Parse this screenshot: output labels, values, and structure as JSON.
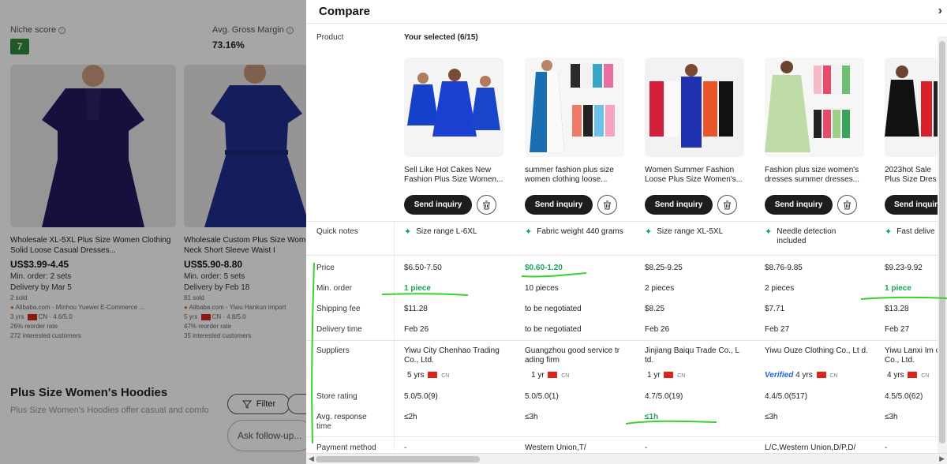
{
  "background": {
    "niche_score_label": "Niche score",
    "niche_score_value": "7",
    "margin_label": "Avg. Gross Margin",
    "margin_value": "73.16%",
    "cards": [
      {
        "title": "Wholesale XL-5XL Plus Size Women Clothing Solid Loose Casual Dresses...",
        "price": "US$3.99-4.45",
        "min_order": "Min. order: 2 sets",
        "delivery": "Delivery by Mar 5",
        "sold": "2 sold",
        "supplier": "Alibaba.com - Minhou Yuewei E-Commerce ...",
        "years": "3 yrs",
        "country_rating": "CN · 4.6/5.0",
        "reorder": "26% reorder rate",
        "interested": "272 interested customers"
      },
      {
        "title": "Wholesale Custom Plus Size Wom Round Neck Short Sleeve Waist I",
        "price": "US$5.90-8.80",
        "min_order": "Min. order: 5 sets",
        "delivery": "Delivery by Feb 18",
        "sold": "81 sold",
        "supplier": "Alibaba.com - Yiwu Hankun Import",
        "years": "5 yrs",
        "country_rating": "CN · 4.8/5.0",
        "reorder": "47% reorder rate",
        "interested": "35 interested customers"
      }
    ],
    "section_title": "Plus Size Women's Hoodies",
    "section_desc": "Plus Size Women's Hoodies offer casual and comfo",
    "filter_label": "Filter",
    "followup_placeholder": "Ask follow-up..."
  },
  "panel": {
    "title": "Compare",
    "labels": {
      "product": "Product",
      "selected": "Your selected (6/15)",
      "quick_notes": "Quick notes",
      "price": "Price",
      "min_order": "Min. order",
      "shipping": "Shipping fee",
      "delivery": "Delivery time",
      "suppliers": "Suppliers",
      "store_rating": "Store rating",
      "response_a": "Avg. response",
      "response_b": "time",
      "payment": "Payment method"
    },
    "send_inquiry_label": "Send inquiry",
    "products": [
      {
        "title": "Sell Like Hot Cakes New Fashion Plus Size Women...",
        "note": "Size range L-6XL",
        "price": "$6.50-7.50",
        "min_order": "1 piece",
        "shipping": "$11.28",
        "delivery": "Feb 26",
        "supplier": "Yiwu City Chenhao Trading Co., Ltd.",
        "years": "5 yrs",
        "verified": "",
        "cn": "CN",
        "rating": "5.0/5.0(9)",
        "response": "≤2h",
        "payment": "-"
      },
      {
        "title": "summer fashion plus size women clothing loose...",
        "note": "Fabric weight 440 grams",
        "price": "$0.60-1.20",
        "min_order": "10 pieces",
        "shipping": "to be negotiated",
        "delivery": "to be negotiated",
        "supplier": "Guangzhou good service tr ading firm",
        "years": "1 yr",
        "verified": "",
        "cn": "CN",
        "rating": "5.0/5.0(1)",
        "response": "≤3h",
        "payment": "Western Union,T/"
      },
      {
        "title": "Women Summer Fashion Loose Plus Size Women's...",
        "note": "Size range XL-5XL",
        "price": "$8.25-9.25",
        "min_order": "2 pieces",
        "shipping": "$8.25",
        "delivery": "Feb 26",
        "supplier": "Jinjiang Baiqu Trade Co., L td.",
        "years": "1 yr",
        "verified": "",
        "cn": "CN",
        "rating": "4.7/5.0(19)",
        "response": "≤1h",
        "payment": "-"
      },
      {
        "title": "Fashion plus size women's dresses summer dresses...",
        "note": "Needle detection included",
        "price": "$8.76-9.85",
        "min_order": "2 pieces",
        "shipping": "$7.71",
        "delivery": "Feb 27",
        "supplier": "Yiwu Ouze Clothing Co., Lt d.",
        "years": "4 yrs",
        "verified": "Verified",
        "cn": "CN",
        "rating": "4.4/5.0(517)",
        "response": "≤3h",
        "payment": "L/C,Western Union,D/P,D/"
      },
      {
        "title": "2023hot Sale Plus Size Dres",
        "note": "Fast delive",
        "price": "$9.23-9.92",
        "min_order": "1 piece",
        "shipping": "$13.28",
        "delivery": "Feb 27",
        "supplier": "Yiwu Lanxi Im ort Co., Ltd.",
        "years": "4 yrs",
        "verified": "",
        "cn": "CN",
        "rating": "4.5/5.0(62)",
        "response": "≤3h",
        "payment": "-"
      }
    ],
    "highlight_colors": {
      "green": "#17a35a",
      "annotation": "#3bd12f"
    }
  }
}
